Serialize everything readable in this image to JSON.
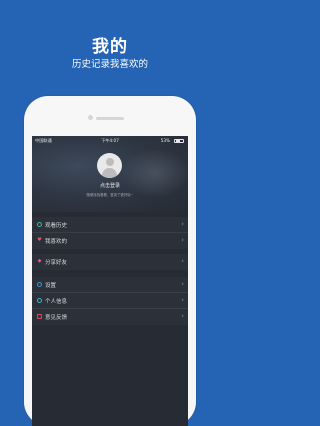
{
  "promo": {
    "title": "我的",
    "subtitle": "历史记录我喜欢的"
  },
  "status_bar": {
    "carrier": "中国联通",
    "time": "下午4:07",
    "battery_text": "53%",
    "battery_level": 0.53
  },
  "profile": {
    "login_label": "点击登录",
    "login_hint": "随便找找看看，登录了更好玩~"
  },
  "menu": {
    "group1": [
      {
        "label": "观看历史",
        "icon": "history-icon",
        "color": "#3db8a8"
      },
      {
        "label": "我喜欢的",
        "icon": "heart-icon",
        "color": "#e05a6a"
      }
    ],
    "group2": [
      {
        "label": "分享好友",
        "icon": "share-icon",
        "color": "#e05a8c"
      }
    ],
    "group3": [
      {
        "label": "设置",
        "icon": "settings-icon",
        "color": "#3a9be0"
      },
      {
        "label": "个人信息",
        "icon": "user-icon",
        "color": "#37b6c8"
      },
      {
        "label": "意见反馈",
        "icon": "feedback-icon",
        "color": "#e04a5a"
      }
    ]
  },
  "colors": {
    "background": "#2563b4",
    "screen": "#272b33",
    "menu_bg": "#2c3038"
  }
}
